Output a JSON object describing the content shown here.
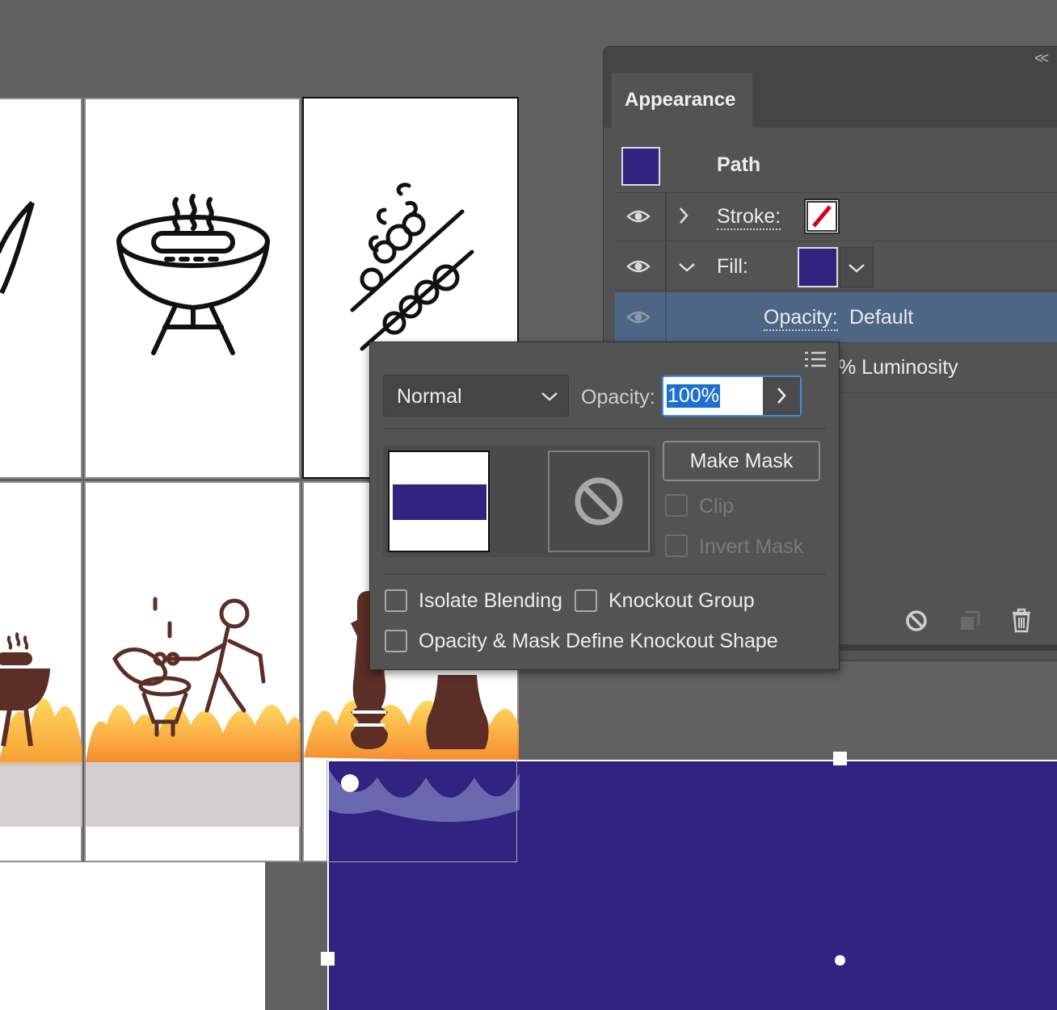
{
  "colors": {
    "fill": "#312480",
    "canvas": "#616161",
    "panel": "#535353",
    "selected_row": "#4d6686",
    "flame_brown": "#5b2e26"
  },
  "appearance": {
    "tab_label": "Appearance",
    "collapse_label": "<<",
    "object_label": "Path",
    "stroke_label": "Stroke:",
    "fill_label": "Fill:",
    "opacity_label": "Opacity:",
    "opacity_value": "Default",
    "luminosity_text": "% Luminosity"
  },
  "transparency": {
    "blend_mode": "Normal",
    "opacity_label": "Opacity:",
    "opacity_value": "100%",
    "make_mask": "Make Mask",
    "clip": "Clip",
    "invert_mask": "Invert Mask",
    "isolate_blending": "Isolate Blending",
    "knockout_group": "Knockout Group",
    "opacity_mask_knockout": "Opacity & Mask Define Knockout Shape"
  },
  "icons": {
    "eye": "eye-icon",
    "chevron_right": "chevron-right-icon",
    "chevron_down": "chevron-down-icon",
    "menu": "menu-icon",
    "no_entry": "prohibited-icon",
    "clear": "clear-appearance-icon",
    "duplicate": "duplicate-item-icon",
    "trash": "trash-icon"
  }
}
